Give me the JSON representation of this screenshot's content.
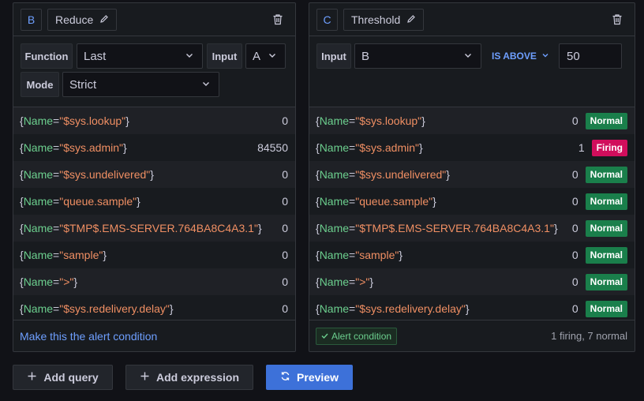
{
  "panel_b": {
    "ref_id": "B",
    "type": "Reduce",
    "function_label": "Function",
    "function_value": "Last",
    "input_label": "Input",
    "input_value": "A",
    "mode_label": "Mode",
    "mode_value": "Strict",
    "rows": [
      {
        "open": "{",
        "key": "Name",
        "eq": "=",
        "quote_open": "\"",
        "value": "$sys.lookup",
        "quote_close": "\"",
        "close": "}",
        "result": "0"
      },
      {
        "open": "{",
        "key": "Name",
        "eq": "=",
        "quote_open": "\"",
        "value": "$sys.admin",
        "quote_close": "\"",
        "close": "}",
        "result": "84550"
      },
      {
        "open": "{",
        "key": "Name",
        "eq": "=",
        "quote_open": "\"",
        "value": "$sys.undelivered",
        "quote_close": "\"",
        "close": "}",
        "result": "0"
      },
      {
        "open": "{",
        "key": "Name",
        "eq": "=",
        "quote_open": "\"",
        "value": "queue.sample",
        "quote_close": "\"",
        "close": "}",
        "result": "0"
      },
      {
        "open": "{",
        "key": "Name",
        "eq": "=",
        "quote_open": "\"",
        "value": "$TMP$.EMS-SERVER.764BA8C4A3.1",
        "quote_close": "\"",
        "close": "}",
        "result": "0"
      },
      {
        "open": "{",
        "key": "Name",
        "eq": "=",
        "quote_open": "\"",
        "value": "sample",
        "quote_close": "\"",
        "close": "}",
        "result": "0"
      },
      {
        "open": "{",
        "key": "Name",
        "eq": "=",
        "quote_open": "\"",
        "value": ">",
        "quote_close": "\"",
        "close": "}",
        "result": "0"
      },
      {
        "open": "{",
        "key": "Name",
        "eq": "=",
        "quote_open": "\"",
        "value": "$sys.redelivery.delay",
        "quote_close": "\"",
        "close": "}",
        "result": "0"
      }
    ],
    "footer_link": "Make this the alert condition"
  },
  "panel_c": {
    "ref_id": "C",
    "type": "Threshold",
    "input_label": "Input",
    "input_value": "B",
    "operator": "IS ABOVE",
    "threshold_value": "50",
    "rows": [
      {
        "open": "{",
        "key": "Name",
        "eq": "=",
        "quote_open": "\"",
        "value": "$sys.lookup",
        "quote_close": "\"",
        "close": "}",
        "result": "0",
        "state": "Normal"
      },
      {
        "open": "{",
        "key": "Name",
        "eq": "=",
        "quote_open": "\"",
        "value": "$sys.admin",
        "quote_close": "\"",
        "close": "}",
        "result": "1",
        "state": "Firing"
      },
      {
        "open": "{",
        "key": "Name",
        "eq": "=",
        "quote_open": "\"",
        "value": "$sys.undelivered",
        "quote_close": "\"",
        "close": "}",
        "result": "0",
        "state": "Normal"
      },
      {
        "open": "{",
        "key": "Name",
        "eq": "=",
        "quote_open": "\"",
        "value": "queue.sample",
        "quote_close": "\"",
        "close": "}",
        "result": "0",
        "state": "Normal"
      },
      {
        "open": "{",
        "key": "Name",
        "eq": "=",
        "quote_open": "\"",
        "value": "$TMP$.EMS-SERVER.764BA8C4A3.1",
        "quote_close": "\"",
        "close": "}",
        "result": "0",
        "state": "Normal"
      },
      {
        "open": "{",
        "key": "Name",
        "eq": "=",
        "quote_open": "\"",
        "value": "sample",
        "quote_close": "\"",
        "close": "}",
        "result": "0",
        "state": "Normal"
      },
      {
        "open": "{",
        "key": "Name",
        "eq": "=",
        "quote_open": "\"",
        "value": ">",
        "quote_close": "\"",
        "close": "}",
        "result": "0",
        "state": "Normal"
      },
      {
        "open": "{",
        "key": "Name",
        "eq": "=",
        "quote_open": "\"",
        "value": "$sys.redelivery.delay",
        "quote_close": "\"",
        "close": "}",
        "result": "0",
        "state": "Normal"
      }
    ],
    "footer_chip": "Alert condition",
    "footer_summary": "1 firing, 7 normal"
  },
  "actions": {
    "add_query": "Add query",
    "add_expression": "Add expression",
    "preview": "Preview"
  },
  "icons": {
    "edit": "pencil-icon",
    "delete": "trash-icon",
    "dropdown": "chevron-down-icon",
    "check": "check-icon",
    "add": "plus-icon",
    "refresh": "sync-icon"
  },
  "colors": {
    "background": "#111217",
    "panel": "#181b1f",
    "accent": "#6e9fff",
    "label_key": "#6ccf8e",
    "label_value": "#f08f63",
    "normal": "#1a7f4b",
    "firing": "#d10e5c",
    "primary_button": "#3d71d9"
  }
}
